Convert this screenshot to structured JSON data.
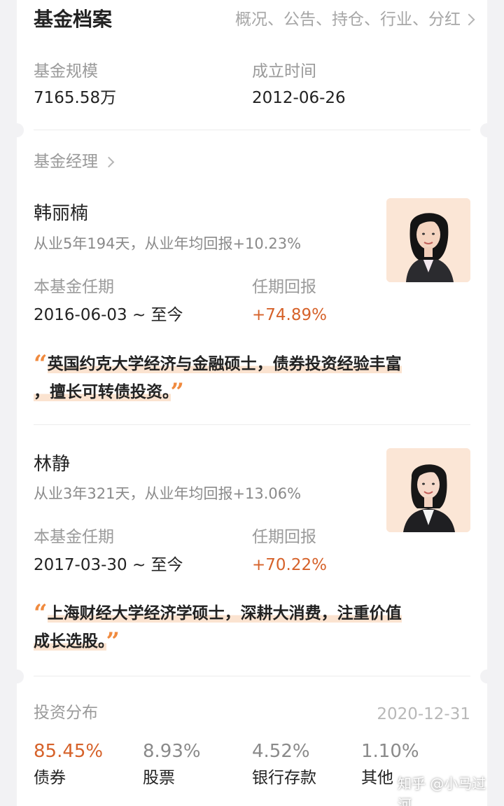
{
  "header": {
    "title": "基金档案",
    "links": "概况、公告、持仓、行业、分红"
  },
  "basic": {
    "size_label": "基金规模",
    "size_value": "7165.58万",
    "founded_label": "成立时间",
    "founded_value": "2012-06-26"
  },
  "manager_section": {
    "title": "基金经理"
  },
  "managers": [
    {
      "name": "韩丽楠",
      "experience": "从业5年194天，从业年均回报+10.23%",
      "tenure_label": "本基金任期",
      "tenure_value": "2016-06-03 ~ 至今",
      "return_label": "任期回报",
      "return_value": "+74.89%",
      "quote_line1": "英国约克大学经济与金融硕士，债券投资经验丰富",
      "quote_line2": "，擅长可转债投资。"
    },
    {
      "name": "林静",
      "experience": "从业3年321天，从业年均回报+13.06%",
      "tenure_label": "本基金任期",
      "tenure_value": "2017-03-30 ~ 至今",
      "return_label": "任期回报",
      "return_value": "+70.22%",
      "quote_line1": "上海财经大学经济学硕士，深耕大消费，注重价值",
      "quote_line2": "成长选股。"
    }
  ],
  "allocation": {
    "title": "投资分布",
    "date": "2020-12-31",
    "items": [
      {
        "percent": "85.45%",
        "name": "债券"
      },
      {
        "percent": "8.93%",
        "name": "股票"
      },
      {
        "percent": "4.52%",
        "name": "银行存款"
      },
      {
        "percent": "1.10%",
        "name": "其他"
      }
    ]
  },
  "watermark": "知乎 @小马过河",
  "colors": {
    "accent_return": "#d6622a",
    "quote_mark": "#f08a3e",
    "quote_highlight": "#fbe3d0"
  }
}
